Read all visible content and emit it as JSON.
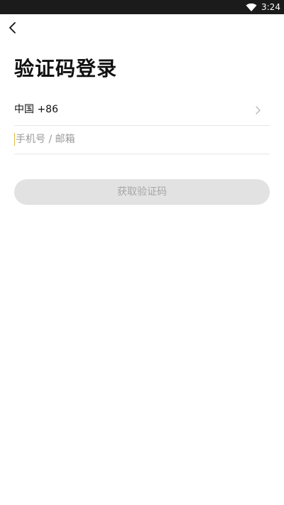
{
  "status_bar": {
    "time": "3:24",
    "wifi_icon": "wifi-icon"
  },
  "header": {
    "back_icon": "chevron-left-icon",
    "title": "验证码登录"
  },
  "form": {
    "country_code_label": "中国 +86",
    "country_chevron_icon": "chevron-right-icon",
    "account_placeholder": "手机号 / 邮箱",
    "account_value": "",
    "submit_label": "获取验证码",
    "submit_enabled": false
  },
  "colors": {
    "status_bar_bg": "#1b1b1b",
    "title_text": "#111111",
    "button_disabled_bg": "#e2e2e2",
    "button_disabled_text": "#a6a6a6",
    "caret": "#e0b83a",
    "divider": "#e6e6e6"
  }
}
